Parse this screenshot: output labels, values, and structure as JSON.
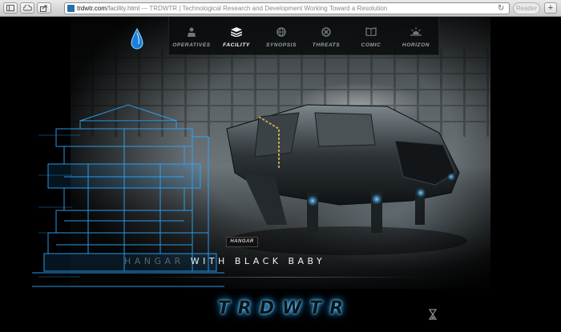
{
  "browser": {
    "url_domain": "trdwtr.com",
    "url_path": "/facility.html",
    "separator": " — ",
    "page_title": "TRDWTR | Technological Research and Development Working Toward a Resolution",
    "reader_label": "Reader"
  },
  "nav": {
    "items": [
      {
        "label": "OPERATIVES",
        "icon": "operative-icon",
        "active": false
      },
      {
        "label": "FACILITY",
        "icon": "layers-icon",
        "active": true
      },
      {
        "label": "SYNOPSIS",
        "icon": "globe-icon",
        "active": false
      },
      {
        "label": "THREATS",
        "icon": "crossed-circle-icon",
        "active": false
      },
      {
        "label": "COMIC",
        "icon": "book-icon",
        "active": false
      },
      {
        "label": "HORIZON",
        "icon": "sunrise-icon",
        "active": false
      }
    ]
  },
  "content": {
    "badge": "HANGAR",
    "caption_dim": "HANGAR",
    "caption_bright": "WITH BLACK BABY",
    "brand": "TRDWTR"
  },
  "colors": {
    "accent": "#2c9be0",
    "nav_active": "#ffffff",
    "nav_inactive": "#9aa3a8"
  }
}
